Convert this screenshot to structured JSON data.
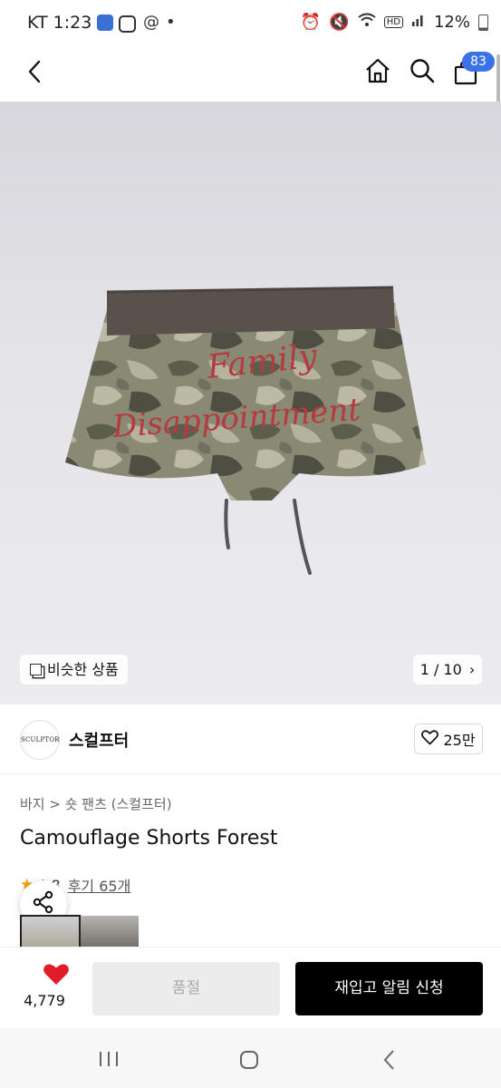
{
  "status_bar": {
    "time": "KT 1:23",
    "dot": "•",
    "battery": "12%",
    "icons": [
      "app-icon-blue",
      "instagram-icon",
      "threads-icon",
      "alarm-icon",
      "mute-icon",
      "wifi-icon",
      "hd-icon",
      "signal-icon",
      "battery-icon"
    ]
  },
  "top_nav": {
    "cart_count": "83"
  },
  "gallery": {
    "similar_label": "비슷한 상품",
    "page_indicator": "1 / 10",
    "print_text_line1": "Family",
    "print_text_line2": "Disappointment"
  },
  "seller": {
    "logo_text": "SCULPTOR",
    "name": "스컬프터",
    "likes": "25만"
  },
  "product": {
    "breadcrumb": "바지 > 숏 팬츠 (스컬프터)",
    "title": "Camouflage Shorts Forest",
    "rating": "4.8",
    "reviews_label": "후기 65개"
  },
  "bottom_bar": {
    "wish_count": "4,779",
    "soldout_label": "품절",
    "restock_label": "재입고 알림 신청"
  },
  "colors": {
    "accent_blue": "#3b73e6",
    "heart_red": "#e21b2a",
    "primary_button": "#000000"
  }
}
